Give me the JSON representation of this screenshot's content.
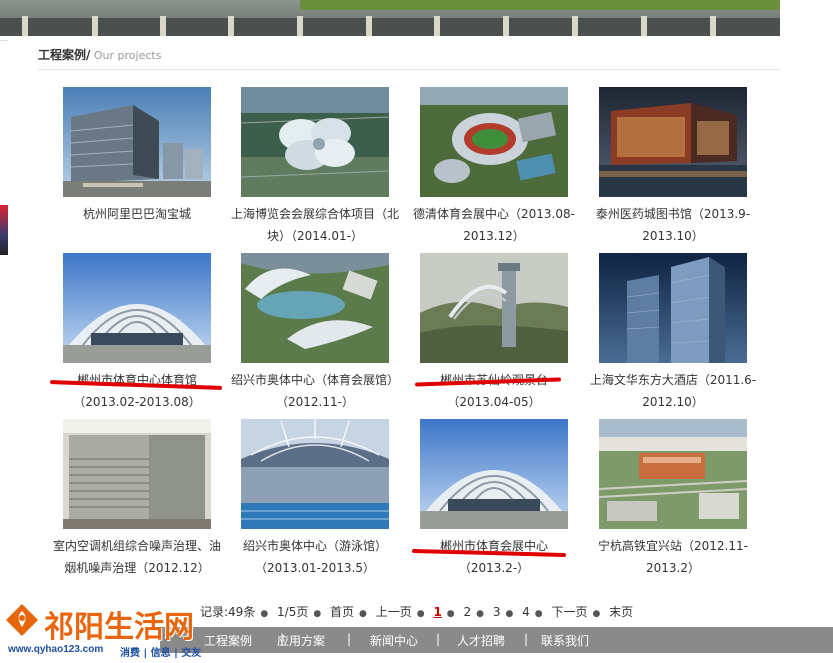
{
  "section": {
    "title": "工程案例/",
    "subtitle": " Our projects"
  },
  "projects": [
    {
      "caption": "杭州阿里巴巴淘宝城",
      "image": "office-buildings-image"
    },
    {
      "caption": "上海博览会会展综合体项目（北块）（2014.01-）",
      "image": "clover-dome-image"
    },
    {
      "caption": "德清体育会展中心（2013.08-2013.12）",
      "image": "stadium-aerial-image"
    },
    {
      "caption": "泰州医药城图书馆（2013.9-2013.10）",
      "image": "library-building-image"
    },
    {
      "caption": "郴州市体育中心体育馆（2013.02-2013.08）",
      "image": "arched-gym-image"
    },
    {
      "caption": "绍兴市奥体中心（体育会展馆）（2012.11-）",
      "image": "lake-complex-image"
    },
    {
      "caption": "郴州市苏仙岭观景台（2013.04-05）",
      "image": "lookout-tower-image"
    },
    {
      "caption": "上海文华东方大酒店（2011.6-2012.10）",
      "image": "glass-towers-image"
    },
    {
      "caption": "室内空调机组综合噪声治理、油烟机噪声治理（2012.12）",
      "image": "ac-units-image"
    },
    {
      "caption": "绍兴市奥体中心（游泳馆）（2013.01-2013.5）",
      "image": "swimming-hall-image"
    },
    {
      "caption": "郴州市体育会展中心（2013.2-）",
      "image": "arched-gym-image"
    },
    {
      "caption": "宁杭高铁宜兴站（2012.11-2013.2）",
      "image": "railway-station-image"
    }
  ],
  "pager": {
    "records": "记录:49条",
    "pages": "1/5页",
    "first": "首页",
    "prev": "上一页",
    "current": "1",
    "p2": "2",
    "p3": "3",
    "p4": "4",
    "next": "下一页",
    "last": "末页",
    "dot": "●"
  },
  "footer_nav": [
    "工程案例",
    "应用方案",
    "新闻中心",
    "人才招聘",
    "联系我们"
  ],
  "footer_sep": "|",
  "watermark": {
    "brand": "祁阳生活网",
    "url": "www.qyhao123.com",
    "tags": "消费 | 信息 | 交友"
  },
  "colors": {
    "annotation_red": "#e00000",
    "footer_bg": "#8a8a8a",
    "brand_orange": "#e8650c"
  }
}
